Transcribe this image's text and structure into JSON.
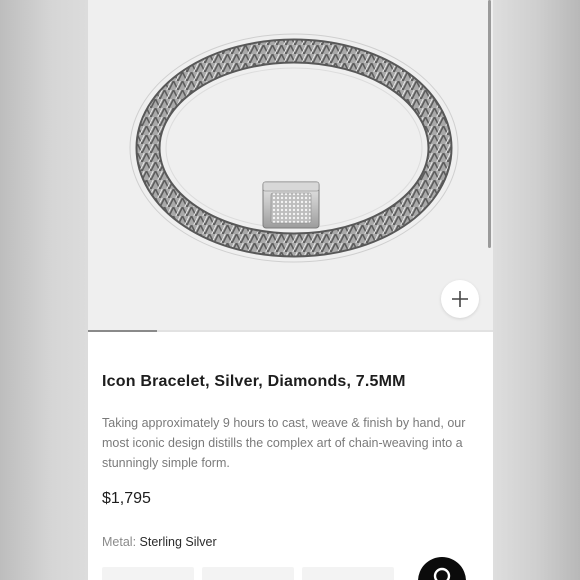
{
  "product": {
    "title": "Icon Bracelet, Silver, Diamonds, 7.5MM",
    "description": "Taking approximately 9 hours to cast, weave & finish by hand, our most iconic design distills the complex art of chain-weaving into a stunningly simple form.",
    "price": "$1,795",
    "metal_label": "Metal",
    "metal_value": "Sterling Silver"
  },
  "gallery": {
    "zoom_icon": "plus-icon",
    "progress_fraction": 0.17
  },
  "options": {
    "chip_count_visible": 3
  },
  "chat": {
    "icon": "chat-bubble-icon"
  },
  "colors": {
    "text_primary": "#1d1d1d",
    "text_secondary": "#7a7a7a",
    "image_background": "#efefef",
    "chat_button": "#0b0b0b"
  }
}
